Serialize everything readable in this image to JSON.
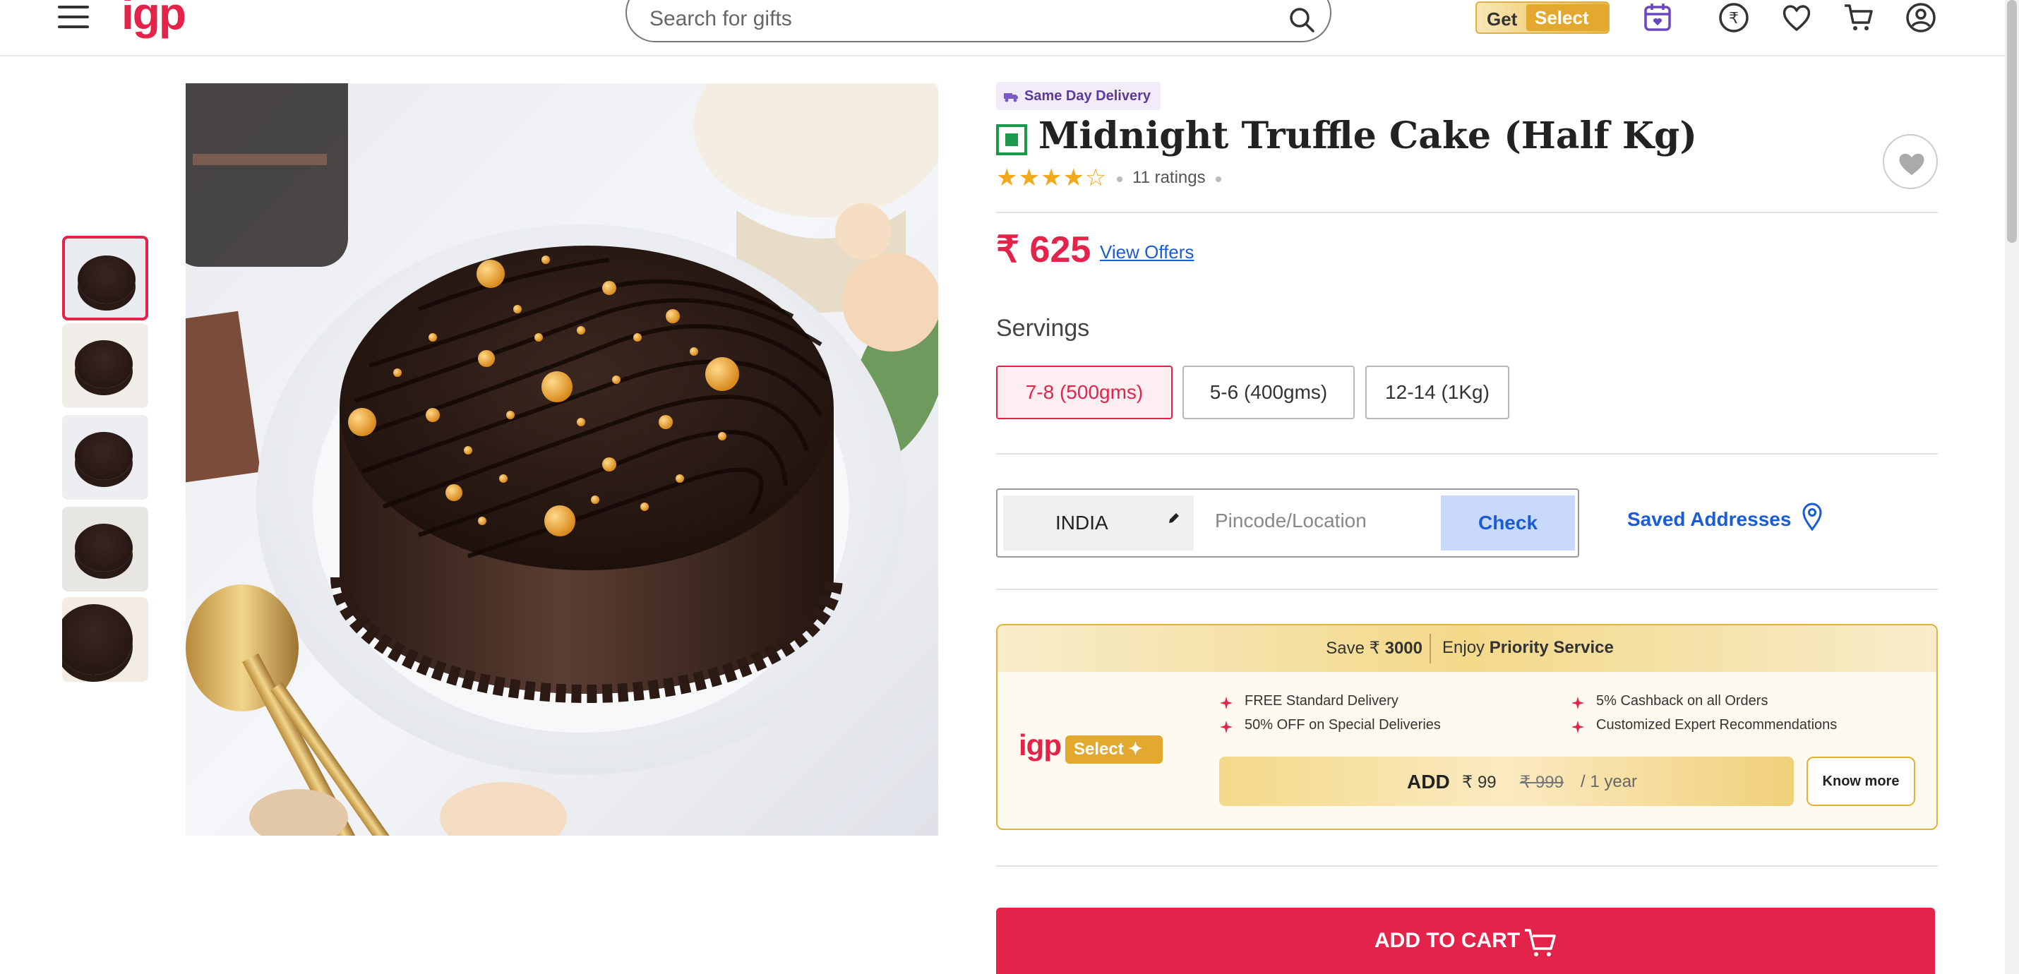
{
  "header": {
    "logo": "igp",
    "search_placeholder": "Search for gifts",
    "get_select": {
      "get": "Get",
      "select": "Select ✦"
    },
    "icons": [
      "menu-icon",
      "search-icon",
      "calendar-icon",
      "rupee-icon",
      "heart-icon",
      "cart-icon",
      "user-icon"
    ]
  },
  "gallery": {
    "thumbnail_count": 5,
    "active_thumbnail": 1
  },
  "product": {
    "badge": "Same Day Delivery",
    "title": "Midnight Truffle Cake (Half Kg)",
    "rating_stars": 4,
    "ratings": "11 ratings",
    "price_symbol": "₹",
    "price": "625",
    "view_offers": "View Offers"
  },
  "servings": {
    "label": "Servings",
    "options": [
      "7-8 (500gms)",
      "5-6 (400gms)",
      "12-14 (1Kg)"
    ],
    "selected": "7-8 (500gms)"
  },
  "delivery": {
    "country": "INDIA",
    "pincode_placeholder": "Pincode/Location",
    "check": "Check",
    "saved_addresses": "Saved Addresses"
  },
  "select_card": {
    "save_prefix": "Save ₹",
    "save_amount": "3000",
    "enjoy_prefix": "Enjoy",
    "enjoy_bold": "Priority Service",
    "logo": "igp",
    "pill": "Select ✦",
    "benefits": [
      "FREE Standard Delivery",
      "50% OFF on Special Deliveries",
      "5% Cashback on all Orders",
      "Customized Expert Recommendations"
    ],
    "add": "ADD",
    "new_price": "₹ 99",
    "old_price": "₹ 999",
    "period": "/ 1 year",
    "know_more": "Know more"
  },
  "cart": {
    "label": "ADD TO CART"
  },
  "colors": {
    "brand_red": "#e3234a",
    "link_blue": "#1a5bd6",
    "gold": "#e3b136",
    "veg_green": "#1b9a4b"
  }
}
